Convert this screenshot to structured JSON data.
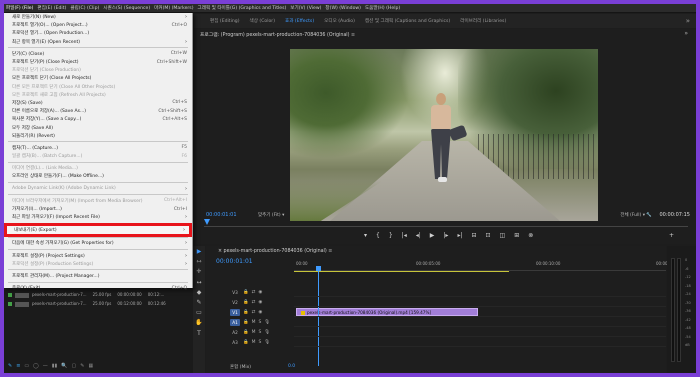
{
  "menubar": {
    "items": [
      "파일(F) (File)",
      "편집(E) (Edit)",
      "클립(C) (Clip)",
      "시퀀스(S) (Sequence)",
      "마커(M) (Markers)",
      "그래픽 및 타이틀(G) (Graphics and Titles)",
      "보기(V) (View)",
      "창(W) (Window)",
      "도움말(H) (Help)"
    ]
  },
  "workspace": {
    "tabs": [
      "편집 (Editing)",
      "색상 (Color)",
      "효과 (Effects)",
      "오디오 (Audio)",
      "캡션 및 그래픽 (Captions and Graphics)",
      "라이브러리 (Libraries)"
    ],
    "active_index": 2,
    "menu_icon": "»"
  },
  "file_menu": {
    "items": [
      {
        "label": "새로 만들기(N) (New)",
        "shortcut": "",
        "submenu": true,
        "disabled": false
      },
      {
        "label": "프로젝트 열기(O)... (Open Project...)",
        "shortcut": "Ctrl+O",
        "submenu": false,
        "disabled": false
      },
      {
        "label": "프로덕션 열기... (Open Production...)",
        "shortcut": "",
        "submenu": false,
        "disabled": false
      },
      {
        "label": "최근 항목 열기(E) (Open Recent)",
        "shortcut": "",
        "submenu": true,
        "disabled": false
      },
      {
        "sep": true
      },
      {
        "label": "닫기(C) (Close)",
        "shortcut": "Ctrl+W",
        "submenu": false,
        "disabled": false
      },
      {
        "label": "프로젝트 닫기(P) (Close Project)",
        "shortcut": "Ctrl+Shift+W",
        "submenu": false,
        "disabled": false
      },
      {
        "label": "프로덕션 닫기 (Close Production)",
        "shortcut": "",
        "submenu": false,
        "disabled": true
      },
      {
        "label": "모든 프로젝트 닫기 (Close All Projects)",
        "shortcut": "",
        "submenu": false,
        "disabled": false
      },
      {
        "label": "다른 모든 프로젝트 닫기 (Close All Other Projects)",
        "shortcut": "",
        "submenu": false,
        "disabled": true
      },
      {
        "label": "모든 프로젝트 새로 고침 (Refresh All Projects)",
        "shortcut": "",
        "submenu": false,
        "disabled": true
      },
      {
        "label": "저장(S) (Save)",
        "shortcut": "Ctrl+S",
        "submenu": false,
        "disabled": false
      },
      {
        "label": "다른 이름으로 저장(A)... (Save As...)",
        "shortcut": "Ctrl+Shift+S",
        "submenu": false,
        "disabled": false
      },
      {
        "label": "복사본 저장(Y)... (Save a Copy...)",
        "shortcut": "Ctrl+Alt+S",
        "submenu": false,
        "disabled": false
      },
      {
        "label": "모두 저장 (Save All)",
        "shortcut": "",
        "submenu": false,
        "disabled": false
      },
      {
        "label": "되돌리기(R) (Revert)",
        "shortcut": "",
        "submenu": false,
        "disabled": false
      },
      {
        "sep": true
      },
      {
        "label": "캡처(T)... (Capture...)",
        "shortcut": "F5",
        "submenu": false,
        "disabled": false
      },
      {
        "label": "일괄 캡처(B)... (Batch Capture...)",
        "shortcut": "F6",
        "submenu": false,
        "disabled": true
      },
      {
        "sep": true
      },
      {
        "label": "미디어 연결(L)... (Link Media...)",
        "shortcut": "",
        "submenu": false,
        "disabled": true
      },
      {
        "label": "오프라인 상태로 만들기(F)... (Make Offline...)",
        "shortcut": "",
        "submenu": false,
        "disabled": false
      },
      {
        "sep": true
      },
      {
        "label": "Adobe Dynamic Link(K) (Adobe Dynamic Link)",
        "shortcut": "",
        "submenu": true,
        "disabled": true
      },
      {
        "sep": true
      },
      {
        "label": "미디어 브라우저에서 가져오기(M) (Import from Media Browser)",
        "shortcut": "Ctrl+Alt+I",
        "submenu": false,
        "disabled": true
      },
      {
        "label": "가져오기(I)... (Import...)",
        "shortcut": "Ctrl+I",
        "submenu": false,
        "disabled": false
      },
      {
        "label": "최근 파일 가져오기(F) (Import Recent File)",
        "shortcut": "",
        "submenu": true,
        "disabled": false
      },
      {
        "sep": true
      },
      {
        "label": "내보내기(E) (Export)",
        "shortcut": "",
        "submenu": true,
        "disabled": false,
        "highlight": true
      },
      {
        "sep": true
      },
      {
        "label": "다음에 대한 속성 가져오기(G) (Get Properties for)",
        "shortcut": "",
        "submenu": true,
        "disabled": false
      },
      {
        "sep": true
      },
      {
        "label": "프로젝트 설정(P) (Project Settings)",
        "shortcut": "",
        "submenu": true,
        "disabled": false
      },
      {
        "label": "프로덕션 설정(P) (Production Settings)",
        "shortcut": "",
        "submenu": true,
        "disabled": true
      },
      {
        "sep": true
      },
      {
        "label": "프로젝트 관리자(M)... (Project Manager...)",
        "shortcut": "",
        "submenu": false,
        "disabled": false
      },
      {
        "sep": true
      },
      {
        "label": "종료(X) (Exit)",
        "shortcut": "Ctrl+Q",
        "submenu": false,
        "disabled": false
      }
    ]
  },
  "program_monitor": {
    "title": "프로그램: (Program) pexels-mart-production-7084036 (Original) ≡",
    "menu_icon": "»",
    "timecode_current": "00:00:01:01",
    "fit_label": "맞추기 (Fit)",
    "quality_label": "전체 (Full)",
    "timecode_duration": "00:00:07:15",
    "transport_icons": [
      "▾",
      "{",
      "}",
      "|◂",
      "◂|",
      "▶",
      "|▸",
      "▸|",
      "⊟",
      "⊡",
      "◫",
      "⊞",
      "⊗"
    ],
    "add_icon": "+"
  },
  "project_panel": {
    "rows": [
      {
        "name": "pexels-mart-production-7...",
        "fps": "25.00 fps",
        "start": "00:00:00:00",
        "end": "00:12:...",
        "selected": true
      },
      {
        "name": "pexels-mart-production-7...",
        "fps": "25.00 fps",
        "start": "00:12:00:00",
        "end": "00:12:46",
        "selected": false
      }
    ],
    "tools": [
      "✎",
      "≡",
      "▭",
      "◯",
      "—",
      "▮▮",
      "🔍",
      "▢",
      "✎",
      "▦"
    ]
  },
  "tools": {
    "icons": [
      "▶",
      "⇿",
      "✛",
      "↔",
      "◆",
      "✎",
      "▭",
      "✋",
      "T"
    ]
  },
  "timeline": {
    "title": "× pexels-mart-production-7084036 (Original) ≡",
    "timecode": "00:00:01:01",
    "ruler_labels": [
      "00:00",
      "00:00:05:00",
      "00:00:10:00",
      "00:00:15:00"
    ],
    "video_tracks": [
      "V3",
      "V2",
      "V1"
    ],
    "audio_tracks": [
      "A1",
      "A2",
      "A3"
    ],
    "clip_label": "pexels-mart-production-7084036 (Original).mp4 [159.47%]",
    "mix_label": "혼합 (Mix)",
    "mix_value": "0.0"
  },
  "meters": {
    "scale": [
      "0",
      "-6",
      "-12",
      "-18",
      "-24",
      "-30",
      "-36",
      "-42",
      "-48",
      "-54",
      "dB"
    ],
    "solo_labels": [
      "S",
      "S"
    ]
  },
  "colors": {
    "accent": "#3f9bff",
    "highlight_box": "#e8141b",
    "clip": "#a27ed8",
    "border": "#7a3fd6"
  }
}
